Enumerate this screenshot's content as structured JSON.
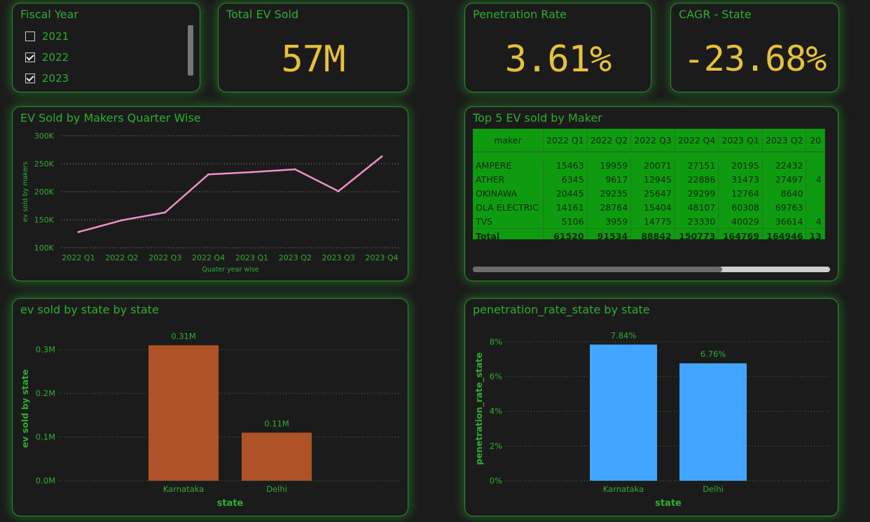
{
  "fiscal_year": {
    "title": "Fiscal Year",
    "options": [
      {
        "label": "2021",
        "checked": false
      },
      {
        "label": "2022",
        "checked": true
      },
      {
        "label": "2023",
        "checked": true
      }
    ]
  },
  "kpis": {
    "total_ev": {
      "title": "Total EV Sold",
      "value": "57M"
    },
    "penetration": {
      "title": "Penetration Rate",
      "value": "3.61%"
    },
    "cagr": {
      "title": "CAGR - State",
      "value": "-23.68%"
    }
  },
  "colors": {
    "accent_green": "#2fae2f",
    "kpi_yellow": "#e8c13a",
    "line_pink": "#f090c8",
    "bar_orange": "#b05228",
    "bar_blue": "#42a5ff",
    "table_green": "#0f9b0f"
  },
  "line_chart": {
    "title": "EV Sold by Makers Quarter Wise",
    "chart_data": {
      "type": "line",
      "categories": [
        "2022 Q1",
        "2022 Q2",
        "2022 Q3",
        "2022 Q4",
        "2023 Q1",
        "2023 Q2",
        "2023 Q3",
        "2023 Q4"
      ],
      "values": [
        128000,
        149000,
        163000,
        231000,
        235000,
        240000,
        201000,
        263000
      ],
      "xlabel": "Quater year wise",
      "ylabel": "ev sold by makers",
      "yticks": [
        "300K",
        "250K",
        "200K",
        "150K",
        "100K"
      ],
      "ylim": [
        100000,
        300000
      ],
      "grid": true
    }
  },
  "table": {
    "title": "Top 5 EV sold by Maker",
    "columns": [
      "maker",
      "2022 Q1",
      "2022 Q2",
      "2022 Q3",
      "2022 Q4",
      "2023 Q1",
      "2023 Q2",
      "20"
    ],
    "rows": [
      [
        "AMPERE",
        "15463",
        "19959",
        "20071",
        "27151",
        "20195",
        "22432",
        ""
      ],
      [
        "ATHER",
        "6345",
        "9617",
        "12945",
        "22886",
        "31473",
        "27497",
        "4"
      ],
      [
        "OKINAWA",
        "20445",
        "29235",
        "25647",
        "29299",
        "12764",
        "8640",
        ""
      ],
      [
        "OLA ELECTRIC",
        "14161",
        "28764",
        "15404",
        "48107",
        "60308",
        "69763",
        ""
      ],
      [
        "TVS",
        "5106",
        "3959",
        "14775",
        "23330",
        "40029",
        "36614",
        "4"
      ]
    ],
    "total": [
      "Total",
      "61520",
      "91534",
      "88842",
      "150773",
      "164769",
      "164946",
      "13"
    ]
  },
  "bar_state": {
    "title": "ev sold by state by state",
    "chart_data": {
      "type": "bar",
      "categories": [
        "Karnataka",
        "Delhi"
      ],
      "values": [
        0.31,
        0.11
      ],
      "data_labels": [
        "0.31M",
        "0.11M"
      ],
      "yticks": [
        "0.3M",
        "0.2M",
        "0.1M",
        "0.0M"
      ],
      "ylim": [
        0,
        0.33
      ],
      "xlabel": "state",
      "ylabel": "ev sold by state",
      "grid": true
    }
  },
  "bar_pen": {
    "title": "penetration_rate_state by state",
    "chart_data": {
      "type": "bar",
      "categories": [
        "Karnataka",
        "Delhi"
      ],
      "values": [
        7.84,
        6.76
      ],
      "data_labels": [
        "7.84%",
        "6.76%"
      ],
      "yticks": [
        "8%",
        "6%",
        "4%",
        "2%",
        "0%"
      ],
      "ylim": [
        0,
        8.3
      ],
      "xlabel": "state",
      "ylabel": "penetration_rate_state",
      "grid": true
    }
  }
}
